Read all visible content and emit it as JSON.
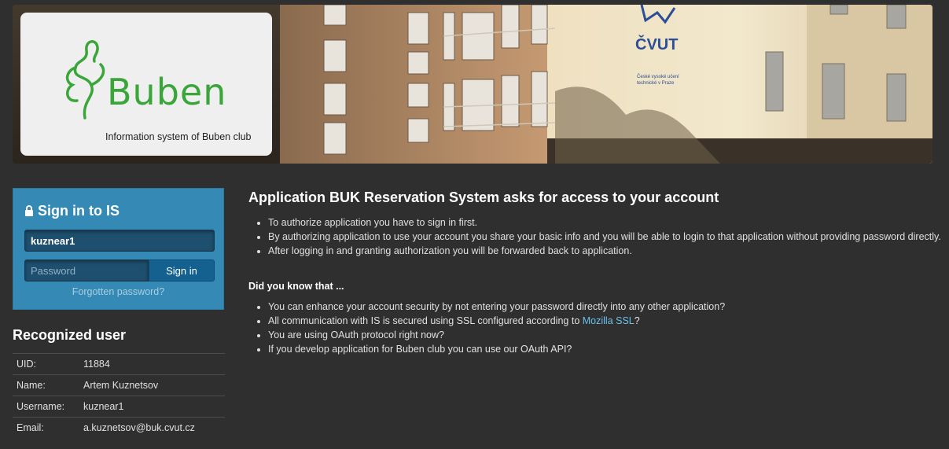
{
  "banner": {
    "logo_text": "Buben",
    "logo_subtitle": "Information system of Buben club",
    "building_sign": "ČVUT",
    "building_sign_small": "České vysoké učení technické v Praze"
  },
  "signin": {
    "title": "Sign in to IS",
    "username_value": "kuznear1",
    "password_placeholder": "Password",
    "button_label": "Sign in",
    "forgot_link": "Forgotten password?"
  },
  "recognized_user": {
    "title": "Recognized user",
    "rows": [
      {
        "key": "UID:",
        "value": "11884"
      },
      {
        "key": "Name:",
        "value": "Artem Kuznetsov"
      },
      {
        "key": "Username:",
        "value": "kuznear1"
      },
      {
        "key": "Email:",
        "value": "a.kuznetsov@buk.cvut.cz"
      }
    ]
  },
  "main": {
    "title": "Application BUK Reservation System asks for access to your account",
    "points": [
      "To authorize application you have to sign in first.",
      "By authorizing application to use your account you share your basic info and you will be able to login to that application without providing password directly.",
      "After logging in and granting authorization you will be forwarded back to application."
    ],
    "did_you_know_title": "Did you know that ...",
    "did_you_know": [
      "You can enhance your account security by not entering your password directly into any other application?",
      "All communication with IS is secured using SSL configured according to ",
      "You are using OAuth protocol right now?",
      "If you develop application for Buben club you can use our OAuth API?"
    ],
    "ssl_link": "Mozilla SSL",
    "ssl_suffix": "?"
  },
  "colors": {
    "background": "#2f2f2f",
    "signin_panel": "#3489b5",
    "link": "#6cc0e8",
    "logo_green": "#3aa63a"
  }
}
